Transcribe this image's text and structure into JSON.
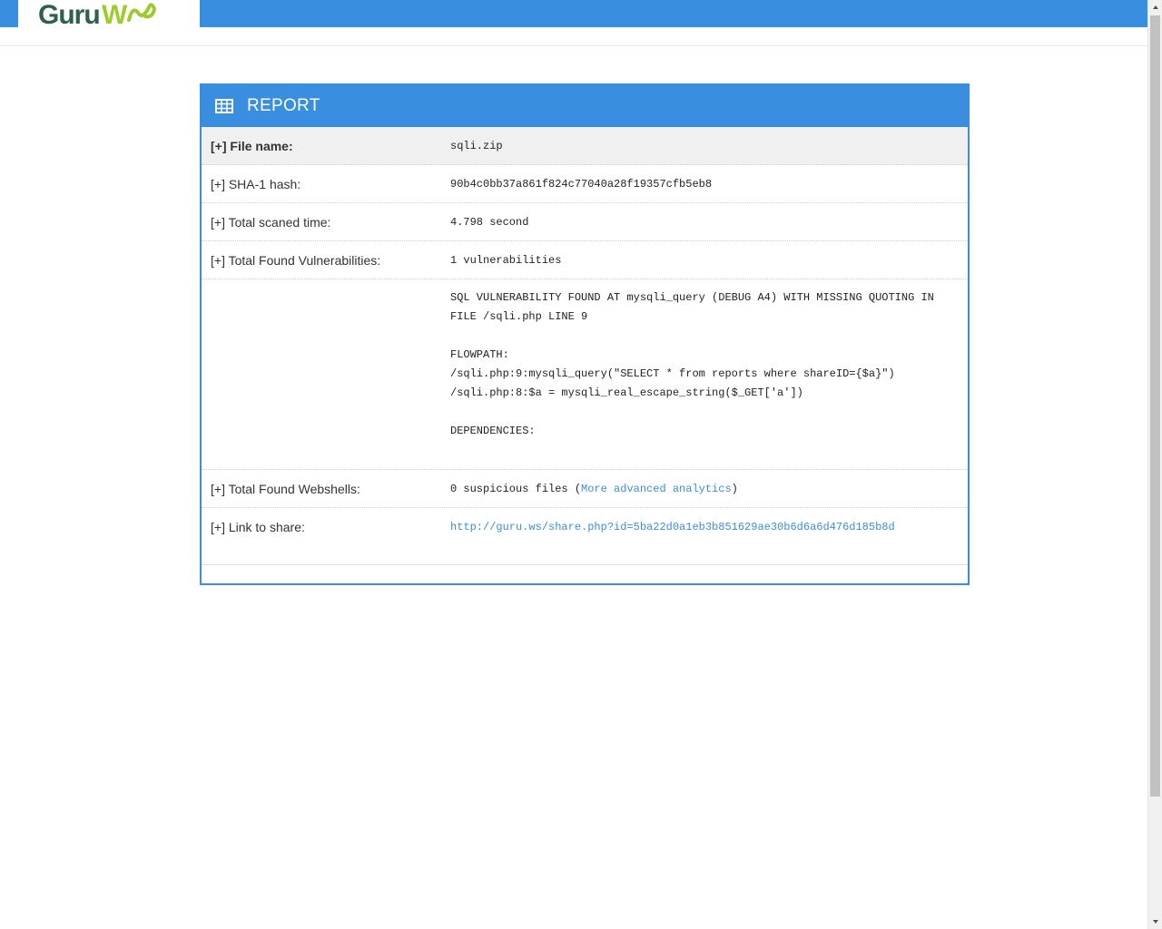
{
  "header": {
    "logo_text": "GuruWS"
  },
  "report": {
    "title": "REPORT",
    "rows": [
      {
        "label": "[+] File name:",
        "value": "sqli.zip"
      },
      {
        "label": "[+] SHA-1 hash:",
        "value": "90b4c0bb37a861f824c77040a28f19357cfb5eb8"
      },
      {
        "label": "[+] Total scaned time:",
        "value": "4.798 second"
      },
      {
        "label": "[+] Total Found Vulnerabilities:",
        "value": "1 vulnerabilities"
      }
    ],
    "vulnerability_details": {
      "line1": "SQL VULNERABILITY FOUND AT mysqli_query (DEBUG A4) WITH MISSING QUOTING IN",
      "line2": "FILE /sqli.php LINE 9",
      "flowpath_label": "FLOWPATH:",
      "flow1": "/sqli.php:9:mysqli_query(\"SELECT * from reports where shareID={$a}\")",
      "flow2": "/sqli.php:8:$a = mysqli_real_escape_string($_GET['a'])",
      "dependencies_label": "DEPENDENCIES:"
    },
    "webshells": {
      "label": "[+] Total Found Webshells:",
      "value_prefix": "0 suspicious files (",
      "link_text": "More advanced analytics",
      "value_suffix": ")"
    },
    "share": {
      "label": "[+] Link to share:",
      "url": "http://guru.ws/share.php?id=5ba22d0a1eb3b851629ae30b6d6a6d476d185b8d"
    }
  },
  "colors": {
    "accent": "#3a8ee0",
    "logo_dark": "#2f5f4f",
    "logo_green": "#9ccc2c"
  }
}
